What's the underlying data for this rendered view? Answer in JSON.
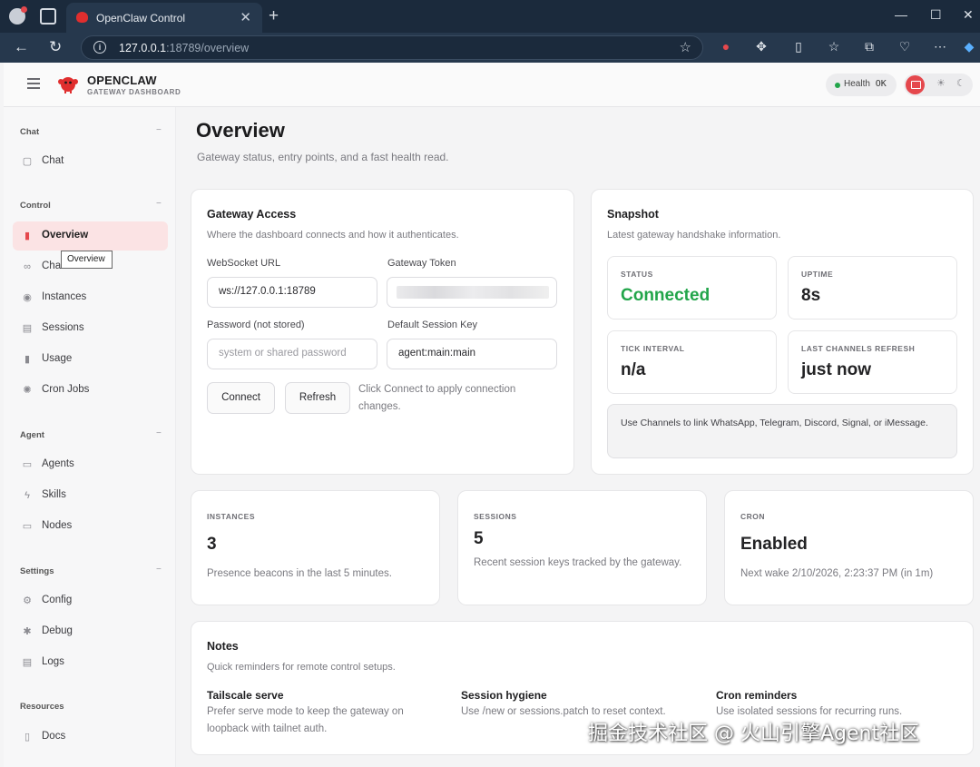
{
  "browser": {
    "tab_title": "OpenClaw Control",
    "url_host": "127.0.0.1",
    "url_rest": ":18789/overview"
  },
  "header": {
    "brand": "OPENCLAW",
    "brand_sub": "GATEWAY DASHBOARD",
    "health_label": "Health",
    "health_value": "OK",
    "health_color": "#22a54a",
    "accent_color": "#e5484d"
  },
  "sidebar": {
    "groups": {
      "chat": "Chat",
      "control": "Control",
      "agent": "Agent",
      "settings": "Settings",
      "resources": "Resources"
    },
    "items": {
      "chat": "Chat",
      "overview": "Overview",
      "channels": "Channels",
      "instances": "Instances",
      "sessions": "Sessions",
      "usage": "Usage",
      "cron": "Cron Jobs",
      "agents": "Agents",
      "skills": "Skills",
      "nodes": "Nodes",
      "config": "Config",
      "debug": "Debug",
      "logs": "Logs",
      "docs": "Docs"
    },
    "tooltip": "Overview"
  },
  "main": {
    "title": "Overview",
    "subtitle": "Gateway status, entry points, and a fast health read."
  },
  "gateway": {
    "title": "Gateway Access",
    "subtitle": "Where the dashboard connects and how it authenticates.",
    "ws_label": "WebSocket URL",
    "ws_value": "ws://127.0.0.1:18789",
    "token_label": "Gateway Token",
    "password_label": "Password (not stored)",
    "password_placeholder": "system or shared password",
    "session_key_label": "Default Session Key",
    "session_key_value": "agent:main:main",
    "connect": "Connect",
    "refresh": "Refresh",
    "hint": "Click Connect to apply connection changes."
  },
  "snapshot": {
    "title": "Snapshot",
    "subtitle": "Latest gateway handshake information.",
    "status_k": "STATUS",
    "status_v": "Connected",
    "uptime_k": "UPTIME",
    "uptime_v": "8s",
    "tick_k": "TICK INTERVAL",
    "tick_v": "n/a",
    "refresh_k": "LAST CHANNELS REFRESH",
    "refresh_v": "just now",
    "note": "Use Channels to link WhatsApp, Telegram, Discord, Signal, or iMessage."
  },
  "stats": {
    "instances_k": "INSTANCES",
    "instances_v": "3",
    "instances_d": "Presence beacons in the last 5 minutes.",
    "sessions_k": "SESSIONS",
    "sessions_v": "5",
    "sessions_d": "Recent session keys tracked by the gateway.",
    "cron_k": "CRON",
    "cron_v": "Enabled",
    "cron_d": "Next wake 2/10/2026, 2:23:37 PM (in 1m)"
  },
  "notes": {
    "title": "Notes",
    "subtitle": "Quick reminders for remote control setups.",
    "n1_h": "Tailscale serve",
    "n1_b": "Prefer serve mode to keep the gateway on loopback with tailnet auth.",
    "n2_h": "Session hygiene",
    "n2_b": "Use /new or sessions.patch to reset context.",
    "n3_h": "Cron reminders",
    "n3_b": "Use isolated sessions for recurring runs."
  },
  "watermark": "掘金技术社区 @ 火山引擎Agent社区"
}
